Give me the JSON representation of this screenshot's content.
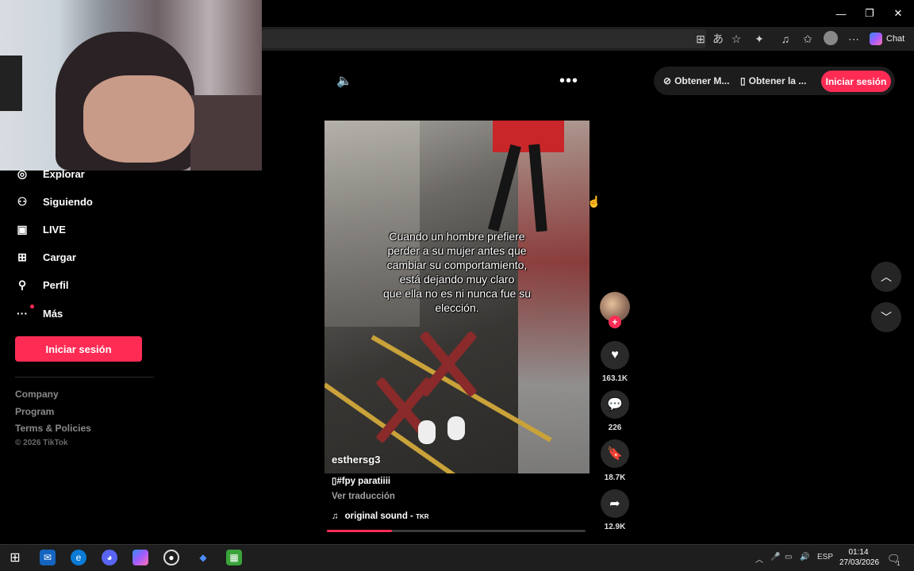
{
  "browser": {
    "chat_label": "Chat",
    "window_buttons": [
      "—",
      "❐",
      "✕"
    ]
  },
  "sidebar": {
    "items": [
      {
        "label": "Explorar",
        "icon": "compass-icon"
      },
      {
        "label": "Siguiendo",
        "icon": "user-follow-icon"
      },
      {
        "label": "LIVE",
        "icon": "live-tv-icon"
      },
      {
        "label": "Cargar",
        "icon": "upload-plus-icon"
      },
      {
        "label": "Perfil",
        "icon": "person-icon"
      },
      {
        "label": "Más",
        "icon": "more-dots-icon"
      }
    ],
    "login_label": "Iniciar sesión",
    "footer": [
      "Company",
      "Program",
      "Terms & Policies"
    ],
    "copyright": "© 2026 TikTok"
  },
  "header": {
    "get_app_1": "Obtener M...",
    "get_app_2": "Obtener la ...",
    "login_label": "Iniciar sesión"
  },
  "video": {
    "caption": "Cuando un hombre prefiere\nperder a su mujer antes que\ncambiar su comportamiento,\nestá dejando muy claro\nque ella no es ni nunca fue su\nelección.",
    "author": "esthersg3",
    "description": "#fpy paratiiii",
    "translate_label": "Ver traducción",
    "sound": "original sound -",
    "sound_tag": "TKR",
    "progress": 0.25
  },
  "actions": {
    "likes": "163.1K",
    "comments": "226",
    "saves": "18.7K",
    "shares": "12.9K"
  },
  "taskbar": {
    "language": "ESP",
    "time": "01:14",
    "date": "27/03/2026",
    "notification_count": "1"
  },
  "colors": {
    "accent": "#fe2c55",
    "background": "#000000"
  }
}
